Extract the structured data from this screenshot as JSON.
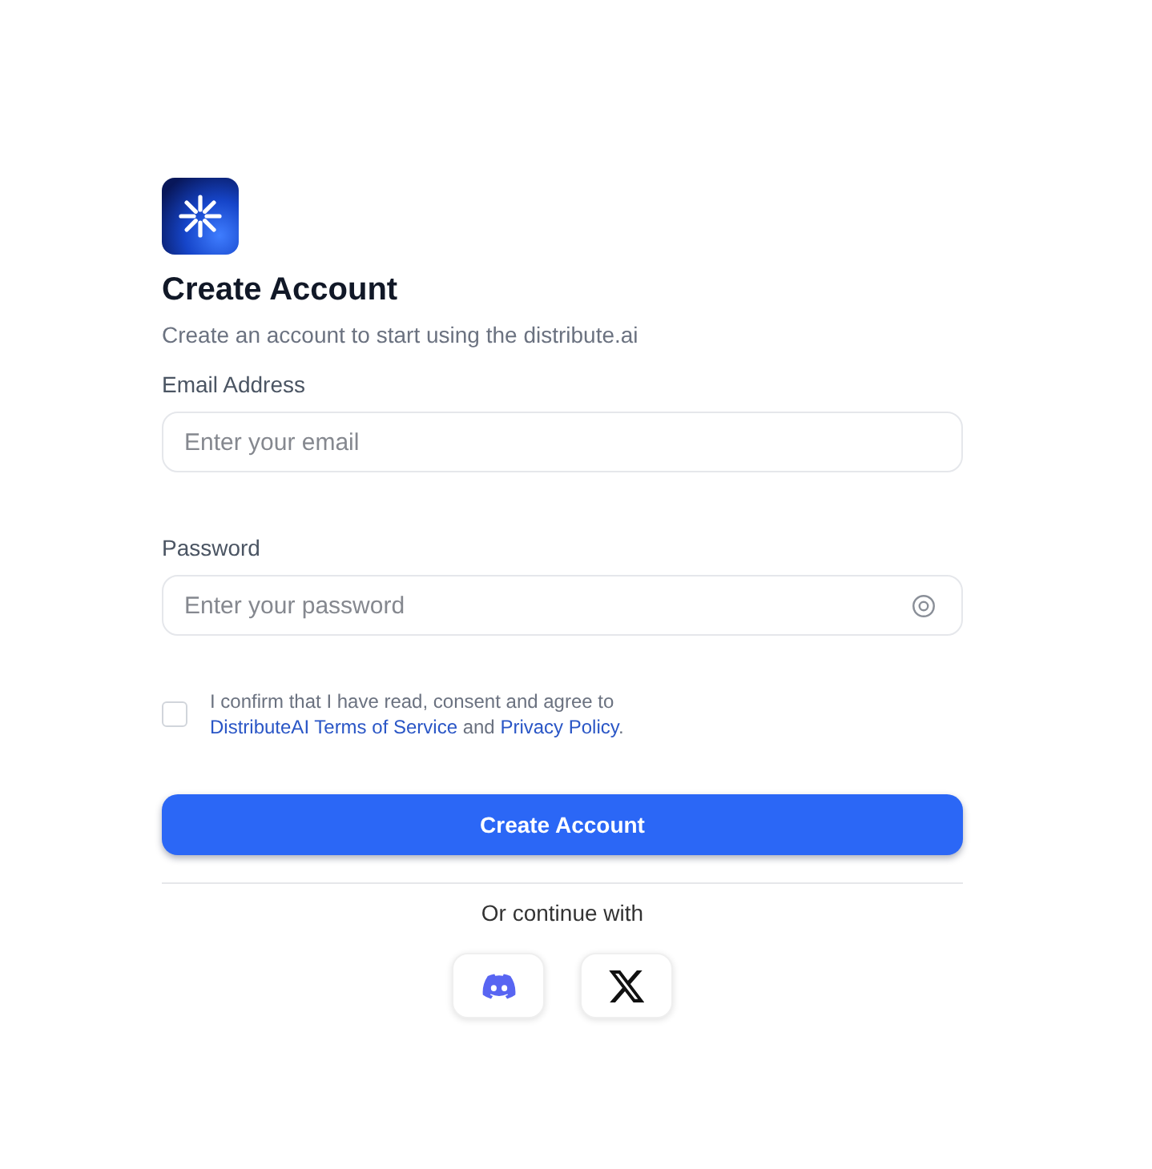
{
  "header": {
    "title": "Create Account",
    "subtitle": "Create an account to start using the distribute.ai"
  },
  "fields": [
    {
      "kind": "email",
      "label": "Email Address",
      "placeholder": "Enter your email"
    },
    {
      "kind": "password",
      "label": "Password",
      "placeholder": "Enter your password"
    }
  ],
  "consent": {
    "checked": false,
    "lines": [
      [
        {
          "kind": "text",
          "text": "I confirm that I have read, consent and agree to"
        }
      ],
      [
        {
          "kind": "link",
          "text": "DistributeAI Terms of Service"
        },
        {
          "kind": "text",
          "text": " and "
        },
        {
          "kind": "link",
          "text": "Privacy Policy"
        },
        {
          "kind": "text",
          "text": "."
        }
      ]
    ]
  },
  "submit_button": "Create Account",
  "divider_text": "Or continue with",
  "social_buttons": [
    {
      "kind": "discord"
    },
    {
      "kind": "x"
    }
  ]
}
